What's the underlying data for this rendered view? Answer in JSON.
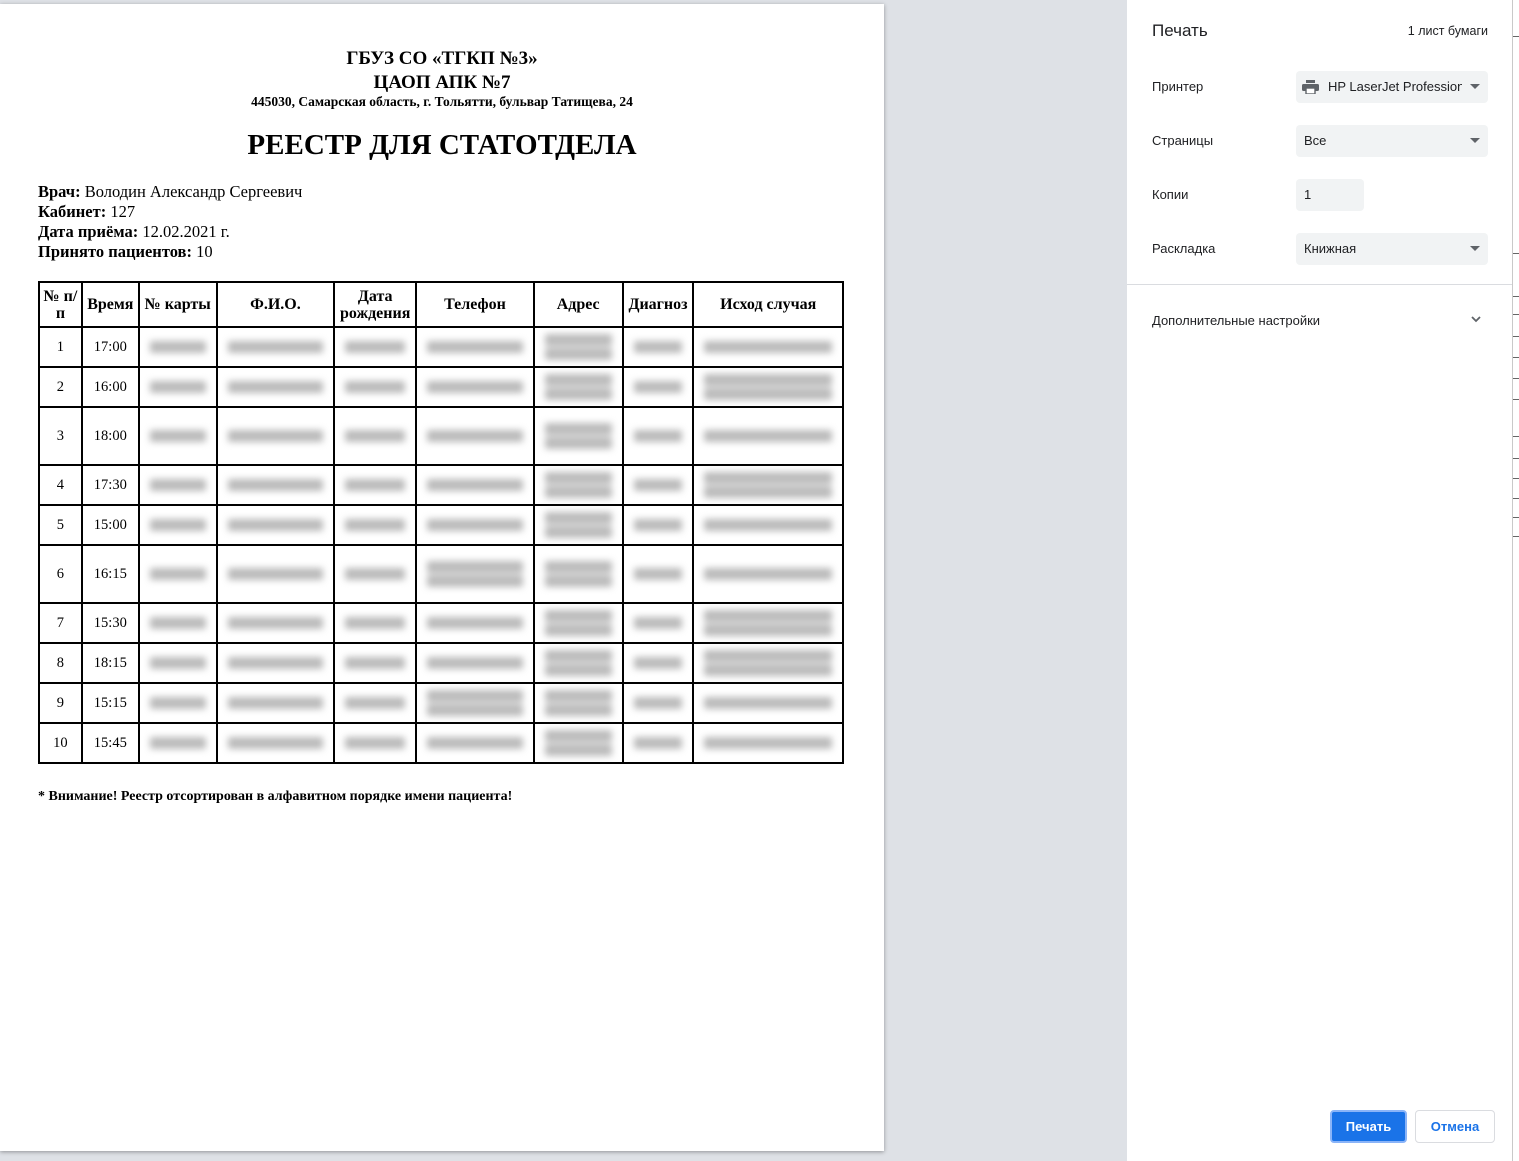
{
  "document": {
    "org_line1": "ГБУЗ СО «ТГКП №3»",
    "org_line2": "ЦАОП АПК №7",
    "address": "445030, Самарская область, г. Тольятти, бульвар Татищева, 24",
    "title": "РЕЕСТР ДЛЯ СТАТОТДЕЛА",
    "doctor_label": "Врач:",
    "doctor_value": " Володин Александр Сергеевич",
    "cabinet_label": "Кабинет:",
    "cabinet_value": " 127",
    "date_label": "Дата приёма:",
    "date_value": " 12.02.2021 г.",
    "patients_label": "Принято пациентов:",
    "patients_value": " 10",
    "note": "* Внимание! Реестр отсортирован в алфавитном порядке имени пациента!"
  },
  "table": {
    "headers": {
      "num": "№ п/п",
      "time": "Время",
      "card": "№ карты",
      "fio": "Ф.И.О.",
      "dob": "Дата рождения",
      "phone": "Телефон",
      "address": "Адрес",
      "diagnosis": "Диагноз",
      "outcome": "Исход случая"
    },
    "rows": [
      {
        "num": "1",
        "time": "17:00"
      },
      {
        "num": "2",
        "time": "16:00"
      },
      {
        "num": "3",
        "time": "18:00"
      },
      {
        "num": "4",
        "time": "17:30"
      },
      {
        "num": "5",
        "time": "15:00"
      },
      {
        "num": "6",
        "time": "16:15"
      },
      {
        "num": "7",
        "time": "15:30"
      },
      {
        "num": "8",
        "time": "18:15"
      },
      {
        "num": "9",
        "time": "15:15"
      },
      {
        "num": "10",
        "time": "15:45"
      }
    ]
  },
  "print_panel": {
    "title": "Печать",
    "sheets": "1 лист бумаги",
    "printer_label": "Принтер",
    "printer_value": "HP LaserJet Professional",
    "pages_label": "Страницы",
    "pages_value": "Все",
    "copies_label": "Копии",
    "copies_value": "1",
    "layout_label": "Раскладка",
    "layout_value": "Книжная",
    "more_settings": "Дополнительные настройки",
    "print_button": "Печать",
    "cancel_button": "Отмена",
    "accent_color": "#1a73e8"
  }
}
